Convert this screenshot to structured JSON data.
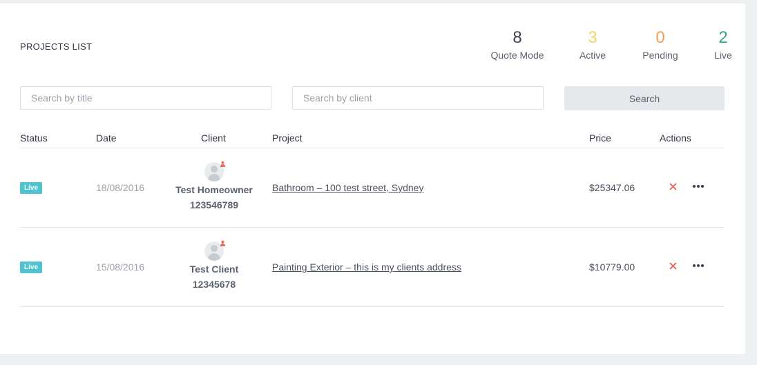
{
  "header": {
    "title": "PROJECTS LIST",
    "stats": [
      {
        "value": "8",
        "label": "Quote Mode",
        "color": "#3b4150"
      },
      {
        "value": "3",
        "label": "Active",
        "color": "#f3d36b"
      },
      {
        "value": "0",
        "label": "Pending",
        "color": "#f0a05a"
      },
      {
        "value": "2",
        "label": "Live",
        "color": "#3aa67a"
      }
    ]
  },
  "search": {
    "title_placeholder": "Search by title",
    "client_placeholder": "Search by client",
    "button_label": "Search"
  },
  "table": {
    "columns": [
      "Status",
      "Date",
      "Client",
      "Project",
      "Price",
      "Actions"
    ],
    "rows": [
      {
        "status": "Live",
        "date": "18/08/2016",
        "client_name": "Test Homeowner",
        "client_id": "123546789",
        "project": "Bathroom – 100 test street, Sydney",
        "price": "$25347.06"
      },
      {
        "status": "Live",
        "date": "15/08/2016",
        "client_name": "Test Client",
        "client_id": "12345678",
        "project": "Painting Exterior – this is my clients address",
        "price": "$10779.00"
      }
    ]
  },
  "icons": {
    "avatar": "user-avatar-icon",
    "avatar_badge": "person-badge-icon",
    "delete": "close-icon",
    "more": "more-dots-icon"
  },
  "colors": {
    "live_badge": "#4fc3ce",
    "delete_icon": "#e86b5f",
    "avatar_badge": "#e86b5f"
  }
}
